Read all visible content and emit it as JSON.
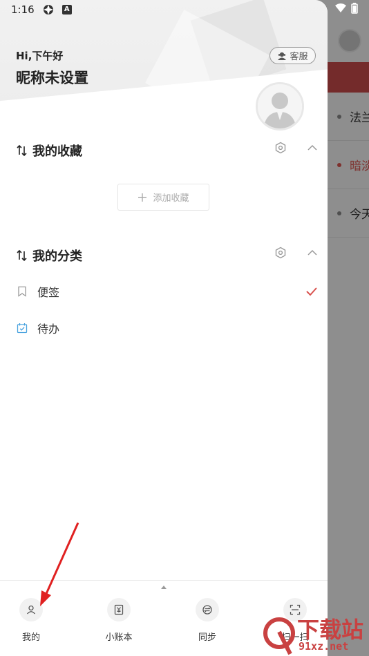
{
  "status_bar": {
    "time": "1:16"
  },
  "background_app": {
    "items": [
      {
        "label": "法兰",
        "highlighted": false
      },
      {
        "label": "暗淡",
        "highlighted": true
      },
      {
        "label": "今天",
        "highlighted": false
      }
    ]
  },
  "header": {
    "greeting": "Hi,下午好",
    "nickname": "昵称未设置",
    "service_label": "客服"
  },
  "favorites": {
    "title": "我的收藏",
    "add_label": "添加收藏"
  },
  "categories": {
    "title": "我的分类",
    "items": [
      {
        "label": "便签",
        "icon": "bookmark-icon",
        "selected": true
      },
      {
        "label": "待办",
        "icon": "calendar-check-icon",
        "selected": false
      }
    ]
  },
  "tabbar": {
    "tabs": [
      {
        "label": "我的",
        "icon": "user-icon"
      },
      {
        "label": "小账本",
        "icon": "ledger-icon"
      },
      {
        "label": "同步",
        "icon": "sync-icon"
      },
      {
        "label": "扫一扫",
        "icon": "scan-icon"
      }
    ]
  },
  "watermark": {
    "line1": "下载站",
    "line2": "91xz.net"
  },
  "colors": {
    "accent_red": "#d9534f",
    "todo_blue": "#4aa3df"
  }
}
